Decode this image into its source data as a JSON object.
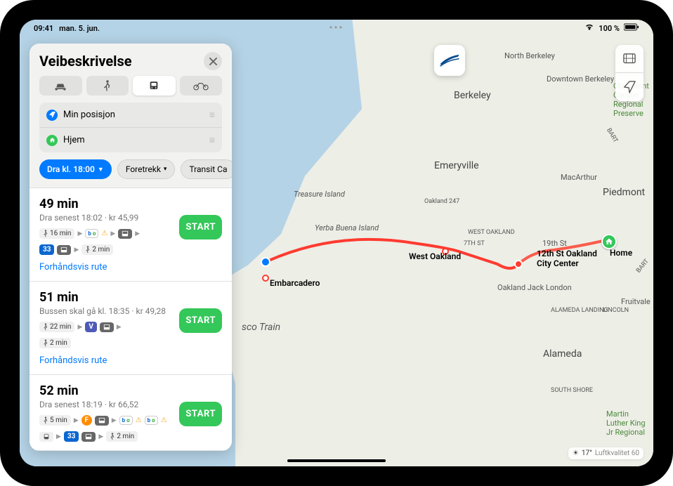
{
  "status": {
    "time": "09:41",
    "date": "man. 5. jun.",
    "wifi": "wifi-icon",
    "battery": "100 %"
  },
  "panel": {
    "title": "Veibeskrivelse",
    "modes": [
      "car",
      "walk",
      "transit",
      "bike"
    ],
    "waypoints": {
      "from": "Min posisjon",
      "to": "Hjem"
    },
    "options": {
      "depart": "Dra kl. 18:00",
      "prefer": "Foretrekk",
      "card": "Transit Ca"
    }
  },
  "routes": [
    {
      "duration": "49 min",
      "subtitle": "Dra senest 18:02 · kr 45,99",
      "line1": [
        {
          "kind": "walk",
          "text": "16 min"
        },
        "arrow",
        {
          "kind": "bart",
          "text": "bo"
        },
        {
          "kind": "warn"
        },
        "arrow",
        {
          "kind": "bus",
          "text": ""
        },
        "arrow"
      ],
      "line2": [
        {
          "kind": "blue33",
          "text": "33"
        },
        {
          "kind": "bus",
          "text": ""
        },
        "arrow",
        {
          "kind": "walk",
          "text": "2 min"
        }
      ],
      "preview": "Forhåndsvis rute",
      "start": "START"
    },
    {
      "duration": "51 min",
      "subtitle": "Bussen skal gå kl. 18:35 · kr 49,28",
      "line1": [
        {
          "kind": "walk",
          "text": "22 min"
        },
        "arrow",
        {
          "kind": "V",
          "text": "V"
        },
        {
          "kind": "bus",
          "text": ""
        },
        "arrow"
      ],
      "line2": [
        {
          "kind": "walk",
          "text": "2 min"
        }
      ],
      "preview": "Forhåndsvis rute",
      "start": "START"
    },
    {
      "duration": "52 min",
      "subtitle": "Dra senest 18:19 · kr 66,52",
      "line1": [
        {
          "kind": "walk",
          "text": "5 min"
        },
        "arrow",
        {
          "kind": "orangeF",
          "text": "F"
        },
        {
          "kind": "bus",
          "text": ""
        },
        "arrow",
        {
          "kind": "bart",
          "text": "bo"
        },
        {
          "kind": "warn"
        },
        {
          "kind": "bart",
          "text": "bo"
        },
        {
          "kind": "warn"
        }
      ],
      "line2": [
        {
          "kind": "train",
          "text": ""
        },
        "arrow",
        {
          "kind": "blue33",
          "text": "33"
        },
        {
          "kind": "bus",
          "text": ""
        },
        "arrow",
        {
          "kind": "walk",
          "text": "2 min"
        }
      ],
      "preview": "Forhåndsvis rute",
      "start": "START"
    }
  ],
  "map": {
    "labels": {
      "northBerkeley": "North Berkeley",
      "downtownBerkeley": "Downtown Berkeley",
      "berkeley": "Berkeley",
      "claremont": "Claremont Canyon Regional Preserve",
      "emeryville": "Emeryville",
      "treasure": "Treasure Island",
      "yerba": "Yerba Buena Island",
      "westOakland": "WEST OAKLAND",
      "westOaklandStation": "West Oakland",
      "piedmont": "Piedmont",
      "macarthur": "MacArthur",
      "street7th": "7TH ST",
      "street19th": "19th St",
      "twelfth": "12th St Oakland City Center",
      "embarcadero": "Embarcadero",
      "home": "Home",
      "jackLondon": "Oakland Jack London",
      "alamedaLbl": "ALAMEDA LANDING",
      "lincoln": "LINCOLN",
      "fruitvale": "Fruitvale",
      "alameda": "Alameda",
      "southShore": "SOUTH SHORE",
      "sfTrain": "sco Train",
      "mlk": "Martin Luther King Jr Regional",
      "oakland247": "Oakland 247",
      "bart1": "BART",
      "bart2": "BART"
    }
  },
  "weather": {
    "temp": "17°",
    "air": "Luftkvalitet 60"
  }
}
